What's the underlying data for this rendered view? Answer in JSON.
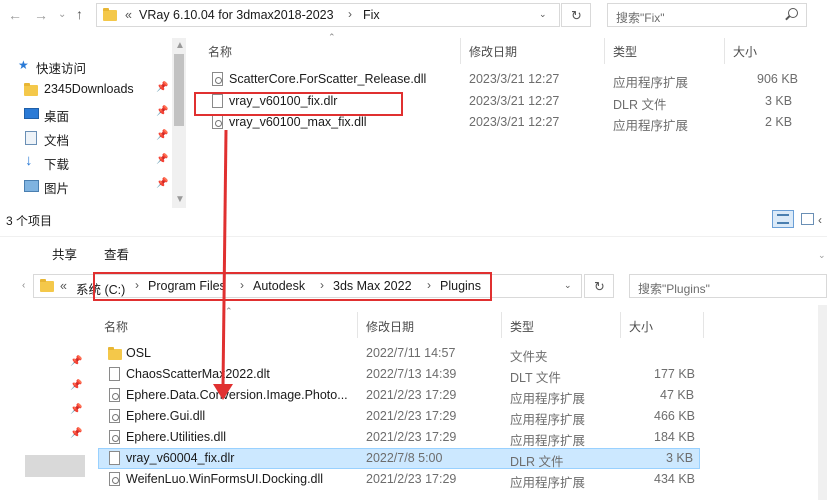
{
  "top": {
    "breadcrumb": [
      "VRay 6.10.04 for 3dmax2018-2023",
      "Fix"
    ],
    "search_placeholder": "搜索\"Fix\"",
    "columns": [
      "名称",
      "修改日期",
      "类型",
      "大小"
    ],
    "files": [
      {
        "name": "ScatterCore.ForScatter_Release.dll",
        "date": "2023/3/21 12:27",
        "type": "应用程序扩展",
        "size": "906 KB",
        "icon": "dll-file-icon"
      },
      {
        "name": "vray_v60100_fix.dlr",
        "date": "2023/3/21 12:27",
        "type": "DLR 文件",
        "size": "3 KB",
        "icon": "dlr-file-icon"
      },
      {
        "name": "vray_v60100_max_fix.dll",
        "date": "2023/3/21 12:27",
        "type": "应用程序扩展",
        "size": "2 KB",
        "icon": "dll-file-icon"
      }
    ],
    "status": "3 个项目"
  },
  "sidebar": {
    "items": [
      {
        "label": "快速访问",
        "icon": "star-icon"
      },
      {
        "label": "2345Downloads",
        "icon": "folder-icon"
      },
      {
        "label": "桌面",
        "icon": "desktop-icon"
      },
      {
        "label": "文档",
        "icon": "document-icon"
      },
      {
        "label": "下载",
        "icon": "download-icon"
      },
      {
        "label": "图片",
        "icon": "picture-icon"
      }
    ]
  },
  "bottom": {
    "ribbon": [
      "共享",
      "查看"
    ],
    "breadcrumb": [
      "系统 (C:)",
      "Program Files",
      "Autodesk",
      "3ds Max 2022",
      "Plugins"
    ],
    "search_placeholder": "搜索\"Plugins\"",
    "columns": [
      "名称",
      "修改日期",
      "类型",
      "大小"
    ],
    "files": [
      {
        "name": "OSL",
        "date": "2022/7/11 14:57",
        "type": "文件夹",
        "size": "",
        "icon": "folder-icon"
      },
      {
        "name": "ChaosScatterMax2022.dlt",
        "date": "2022/7/13 14:39",
        "type": "DLT 文件",
        "size": "177 KB",
        "icon": "file-icon"
      },
      {
        "name": "Ephere.Data.Conversion.Image.Photo...",
        "date": "2021/2/23 17:29",
        "type": "应用程序扩展",
        "size": "47 KB",
        "icon": "dll-file-icon"
      },
      {
        "name": "Ephere.Gui.dll",
        "date": "2021/2/23 17:29",
        "type": "应用程序扩展",
        "size": "466 KB",
        "icon": "dll-file-icon"
      },
      {
        "name": "Ephere.Utilities.dll",
        "date": "2021/2/23 17:29",
        "type": "应用程序扩展",
        "size": "184 KB",
        "icon": "dll-file-icon"
      },
      {
        "name": "vray_v60004_fix.dlr",
        "date": "2022/7/8 5:00",
        "type": "DLR 文件",
        "size": "3 KB",
        "icon": "dlr-file-icon"
      },
      {
        "name": "WeifenLuo.WinFormsUI.Docking.dll",
        "date": "2021/2/23 17:29",
        "type": "应用程序扩展",
        "size": "434 KB",
        "icon": "dll-file-icon"
      }
    ]
  },
  "colors": {
    "highlight": "#e03030",
    "selection": "#cce8ff",
    "folder": "#f4c84a"
  }
}
